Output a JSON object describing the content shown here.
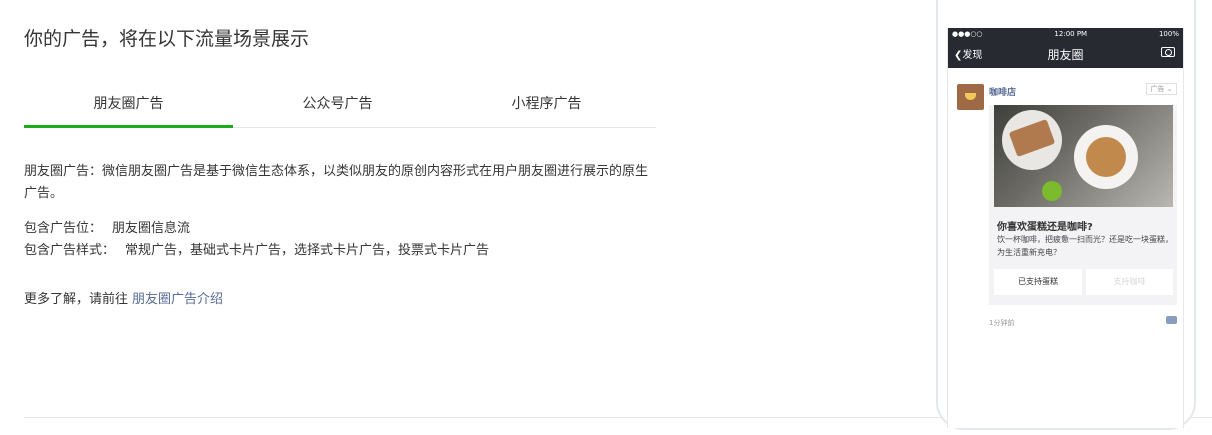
{
  "header": {
    "title": "你的广告，将在以下流量场景展示"
  },
  "tabs": [
    {
      "label": "朋友圈广告",
      "active": true
    },
    {
      "label": "公众号广告",
      "active": false
    },
    {
      "label": "小程序广告",
      "active": false
    }
  ],
  "content": {
    "description": "朋友圈广告：微信朋友圈广告是基于微信生态体系，以类似朋友的原创内容形式在用户朋友圈进行展示的原生广告。",
    "placement_label": "包含广告位：",
    "placement_value": "朋友圈信息流",
    "style_label": "包含广告样式：",
    "style_value": "常规广告，基础式卡片广告，选择式卡片广告，投票式卡片广告",
    "more_prefix": "更多了解，请前往",
    "more_link": "朋友圈广告介绍"
  },
  "phone": {
    "status_left": "●●●○○",
    "time": "12:00 PM",
    "battery": "100%",
    "back_label": "发现",
    "nav_title": "朋友圈",
    "shop_name": "咖啡店",
    "ad_tag": "广告",
    "question": "你喜欢蛋糕还是咖啡?",
    "question_desc": "饮一杯咖啡，把疲惫一扫而光？还是吃一块蛋糕，为生活重新充电？",
    "vote_option_1": "已支持蛋糕",
    "vote_option_2": "支持咖啡",
    "time_ago": "1分钟前"
  },
  "colors": {
    "accent": "#1aad19",
    "link": "#576b95"
  }
}
